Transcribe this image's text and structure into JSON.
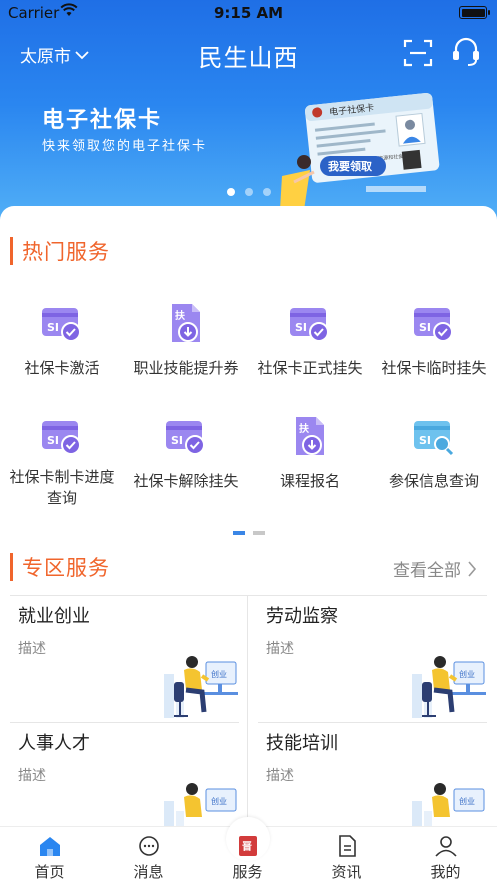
{
  "status_bar": {
    "carrier": "Carrier",
    "time": "9:15 AM"
  },
  "nav": {
    "city": "太原市",
    "title": "民生山西"
  },
  "banner": {
    "title": "电子社保卡",
    "subtitle": "快来领取您的电子社保卡",
    "card_header": "电子社保卡",
    "card_issuer": "人力资源和社会保障部",
    "card_button": "我要领取",
    "slide_count": 3,
    "active_slide": 0
  },
  "hot_services": {
    "title": "热门服务",
    "items": [
      {
        "label": "社保卡激活",
        "icon": "si-card-check-icon"
      },
      {
        "label": "职业技能提升券",
        "icon": "voucher-download-icon"
      },
      {
        "label": "社保卡正式挂失",
        "icon": "si-card-check-icon"
      },
      {
        "label": "社保卡临时挂失",
        "icon": "si-card-check-icon"
      },
      {
        "label": "社保卡制卡进度查询",
        "icon": "si-card-check-icon"
      },
      {
        "label": "社保卡解除挂失",
        "icon": "si-card-check-icon"
      },
      {
        "label": "课程报名",
        "icon": "voucher-download-icon"
      },
      {
        "label": "参保信息查询",
        "icon": "si-card-search-icon"
      }
    ],
    "page_count": 2,
    "active_page": 0
  },
  "zone_services": {
    "title": "专区服务",
    "view_all": "查看全部",
    "items": [
      {
        "title": "就业创业",
        "desc": "描述",
        "art_tag": "创业"
      },
      {
        "title": "劳动监察",
        "desc": "描述",
        "art_tag": "创业"
      },
      {
        "title": "人事人才",
        "desc": "描述",
        "art_tag": "创业"
      },
      {
        "title": "技能培训",
        "desc": "描述",
        "art_tag": "创业"
      }
    ]
  },
  "tabbar": {
    "items": [
      {
        "label": "首页",
        "icon": "home-icon",
        "active": true
      },
      {
        "label": "消息",
        "icon": "message-icon",
        "active": false
      },
      {
        "label": "服务",
        "icon": "service-logo-icon",
        "active": false
      },
      {
        "label": "资讯",
        "icon": "news-icon",
        "active": false
      },
      {
        "label": "我的",
        "icon": "profile-icon",
        "active": false
      }
    ]
  },
  "colors": {
    "accent": "#f0652c",
    "primary_blue": "#2a86f0",
    "service_icon": "#8b6fe8"
  }
}
